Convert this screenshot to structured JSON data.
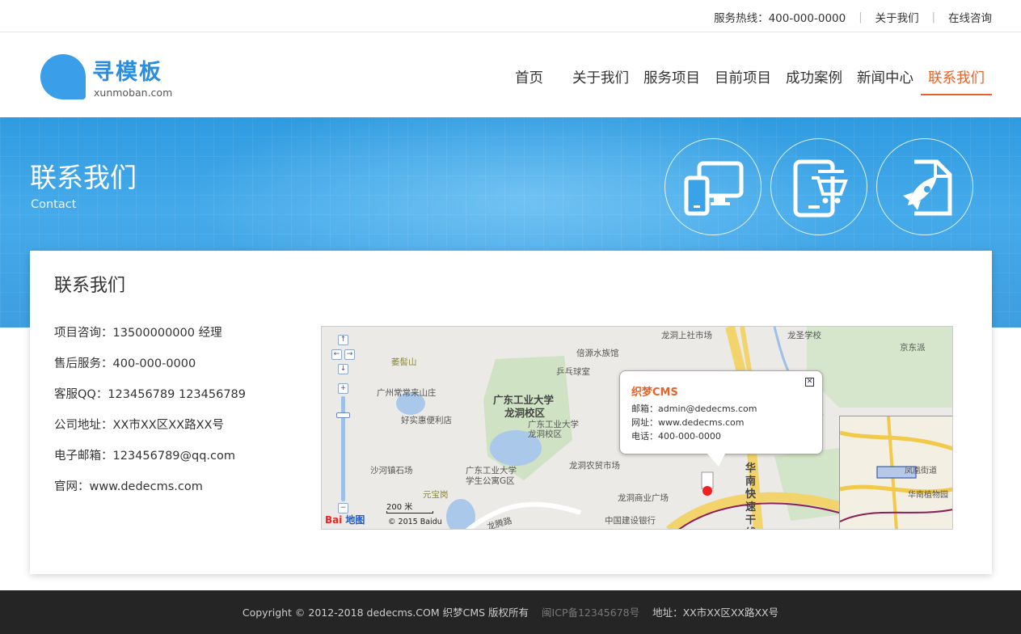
{
  "topbar": {
    "hotline": "服务热线：400-000-0000",
    "about": "关于我们",
    "online": "在线咨询"
  },
  "logo": {
    "brand": "寻模板",
    "domain": "xunmoban.com"
  },
  "nav": [
    {
      "label": "首页",
      "active": false
    },
    {
      "label": "关于我们",
      "active": false
    },
    {
      "label": "服务项目",
      "active": false
    },
    {
      "label": "目前项目",
      "active": false
    },
    {
      "label": "成功案例",
      "active": false
    },
    {
      "label": "新闻中心",
      "active": false
    },
    {
      "label": "联系我们",
      "active": true
    }
  ],
  "banner": {
    "title": "联系我们",
    "subtitle": "Contact",
    "icons": [
      "devices-icon",
      "tablet-cart-icon",
      "rocket-doc-icon"
    ]
  },
  "contact": {
    "heading": "联系我们",
    "rows": [
      "项目咨询：13500000000  经理",
      "售后服务：400-000-0000",
      "客服QQ：123456789  123456789",
      "公司地址：XX市XX区XX路XX号",
      "电子邮箱：123456789@qq.com",
      "官网：www.dedecms.com"
    ]
  },
  "map": {
    "popup": {
      "title": "织梦CMS",
      "email": "邮箱：admin@dedecms.com",
      "site": "网址：www.dedecms.com",
      "phone": "电话：400-000-0000"
    },
    "labels": {
      "l1": "龙洞上社市场",
      "l2": "龙圣学校",
      "l3": "京东派",
      "l4": "倍源水族馆",
      "l5": "萎髻山",
      "l6": "乒乓球室",
      "l7": "广州常常来山庄",
      "l8": "广东工业大学",
      "l9": "龙洞校区",
      "l10": "好实惠便利店",
      "l11": "广东工业大学",
      "l12": "龙洞校区",
      "l13": "沙河镇石场",
      "l14": "广东工业大学",
      "l15": "学生公寓G区",
      "l16": "龙洞农贸市场",
      "l17": "元宝岗",
      "l18": "龙洞商业广场",
      "l19": "中国建设银行",
      "l20": "龙腾路",
      "l21": "华南快速干线",
      "m1": "凤凰街道",
      "m2": "华南植物园"
    },
    "scale": "200 米",
    "copyright": "© 2015 Baidu",
    "logo": "Bai",
    "logo2": "地图"
  },
  "footer": {
    "copyright": "Copyright © 2012-2018 dedecms.COM 织梦CMS 版权所有",
    "icp": "闽ICP备12345678号",
    "address": "地址：XX市XX区XX路XX号"
  },
  "colors": {
    "accent": "#e8622a",
    "brand": "#2a8ee0",
    "banner": "#3aa2e6",
    "footer": "#252525"
  }
}
